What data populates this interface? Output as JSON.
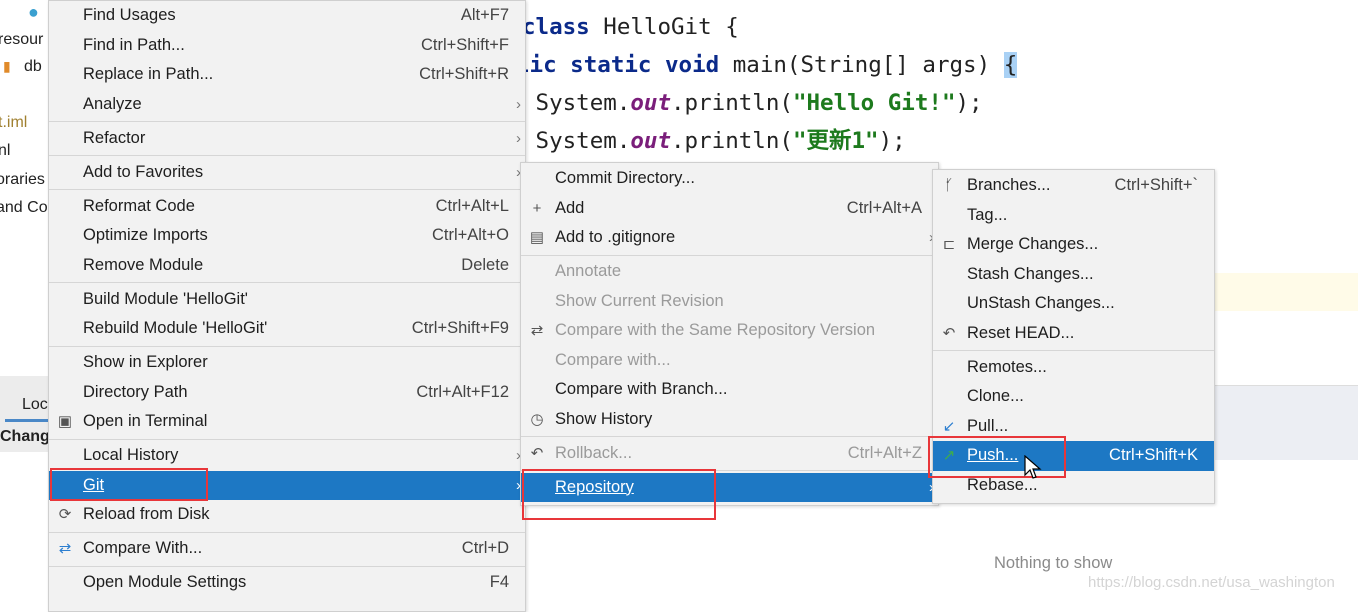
{
  "project_tree": {
    "items": [
      "resour",
      "db",
      "t.iml",
      "nl",
      "oraries",
      "and Co"
    ],
    "tabs": [
      "Loc",
      "Chang"
    ]
  },
  "editor": {
    "lines": [
      {
        "kw": "class",
        "rest": " HelloGit {"
      },
      {
        "kw": "lic static void",
        "rest": " main(String[] args) ",
        "brace": "{"
      },
      {
        "pre": " System.",
        "it": "out",
        "mid": ".println(",
        "str": "\"Hello Git!\"",
        "post": ");"
      },
      {
        "pre": " System.",
        "it": "out",
        "mid": ".println(",
        "str": "\"更新1\"",
        "post": ");"
      }
    ]
  },
  "context_menu": {
    "items": [
      {
        "label": "Find Usages",
        "shortcut": "Alt+F7"
      },
      {
        "label": "Find in Path...",
        "shortcut": "Ctrl+Shift+F"
      },
      {
        "label": "Replace in Path...",
        "shortcut": "Ctrl+Shift+R"
      },
      {
        "label": "Analyze",
        "submenu": true
      },
      {
        "label": "Refactor",
        "submenu": true,
        "separator_before": true
      },
      {
        "label": "Add to Favorites",
        "submenu": true,
        "separator_before": true
      },
      {
        "label": "Reformat Code",
        "shortcut": "Ctrl+Alt+L",
        "separator_before": true
      },
      {
        "label": "Optimize Imports",
        "shortcut": "Ctrl+Alt+O"
      },
      {
        "label": "Remove Module",
        "shortcut": "Delete"
      },
      {
        "label": "Build Module 'HelloGit'",
        "separator_before": true
      },
      {
        "label": "Rebuild Module 'HelloGit'",
        "shortcut": "Ctrl+Shift+F9"
      },
      {
        "label": "Show in Explorer",
        "separator_before": true
      },
      {
        "label": "Directory Path",
        "shortcut": "Ctrl+Alt+F12"
      },
      {
        "label": "Open in Terminal",
        "icon": "terminal-icon"
      },
      {
        "label": "Local History",
        "submenu": true,
        "separator_before": true
      },
      {
        "label": "Git",
        "submenu": true,
        "selected": true
      },
      {
        "label": "Reload from Disk",
        "icon": "reload-icon"
      },
      {
        "label": "Compare With...",
        "shortcut": "Ctrl+D",
        "icon": "compare-icon",
        "separator_before": true
      },
      {
        "label": "Open Module Settings",
        "shortcut": "F4",
        "separator_before": true
      }
    ]
  },
  "git_menu": {
    "items": [
      {
        "label": "Commit Directory..."
      },
      {
        "label": "Add",
        "shortcut": "Ctrl+Alt+A",
        "icon": "plus-icon"
      },
      {
        "label": "Add to .gitignore",
        "submenu": true,
        "icon": "gitignore-file-icon"
      },
      {
        "label": "Annotate",
        "disabled": true,
        "separator_before": true
      },
      {
        "label": "Show Current Revision",
        "disabled": true
      },
      {
        "label": "Compare with the Same Repository Version",
        "disabled": true,
        "icon": "compare-icon"
      },
      {
        "label": "Compare with...",
        "disabled": true
      },
      {
        "label": "Compare with Branch..."
      },
      {
        "label": "Show History",
        "icon": "clock-icon"
      },
      {
        "label": "Rollback...",
        "shortcut": "Ctrl+Alt+Z",
        "disabled": true,
        "icon": "undo-icon",
        "separator_before": true
      },
      {
        "label": "Repository",
        "submenu": true,
        "selected": true,
        "separator_before": true
      }
    ]
  },
  "repository_menu": {
    "items": [
      {
        "label": "Branches...",
        "shortcut": "Ctrl+Shift+`",
        "icon": "branch-icon"
      },
      {
        "label": "Tag..."
      },
      {
        "label": "Merge Changes...",
        "icon": "merge-icon"
      },
      {
        "label": "Stash Changes..."
      },
      {
        "label": "UnStash Changes..."
      },
      {
        "label": "Reset HEAD...",
        "icon": "undo-icon"
      },
      {
        "label": "Remotes...",
        "separator_before": true
      },
      {
        "label": "Clone..."
      },
      {
        "label": "Pull...",
        "icon": "pull-arrow-icon"
      },
      {
        "label": "Push...",
        "shortcut": "Ctrl+Shift+K",
        "icon": "push-arrow-icon",
        "selected": true
      },
      {
        "label": "Rebase..."
      }
    ]
  },
  "status": {
    "empty_text": "Nothing to show"
  },
  "watermark": "https://blog.csdn.net/usa_washington",
  "colors": {
    "selection": "#1d78c4",
    "highlight_box": "#e8363a",
    "menu_bg": "#f2f2f2"
  }
}
